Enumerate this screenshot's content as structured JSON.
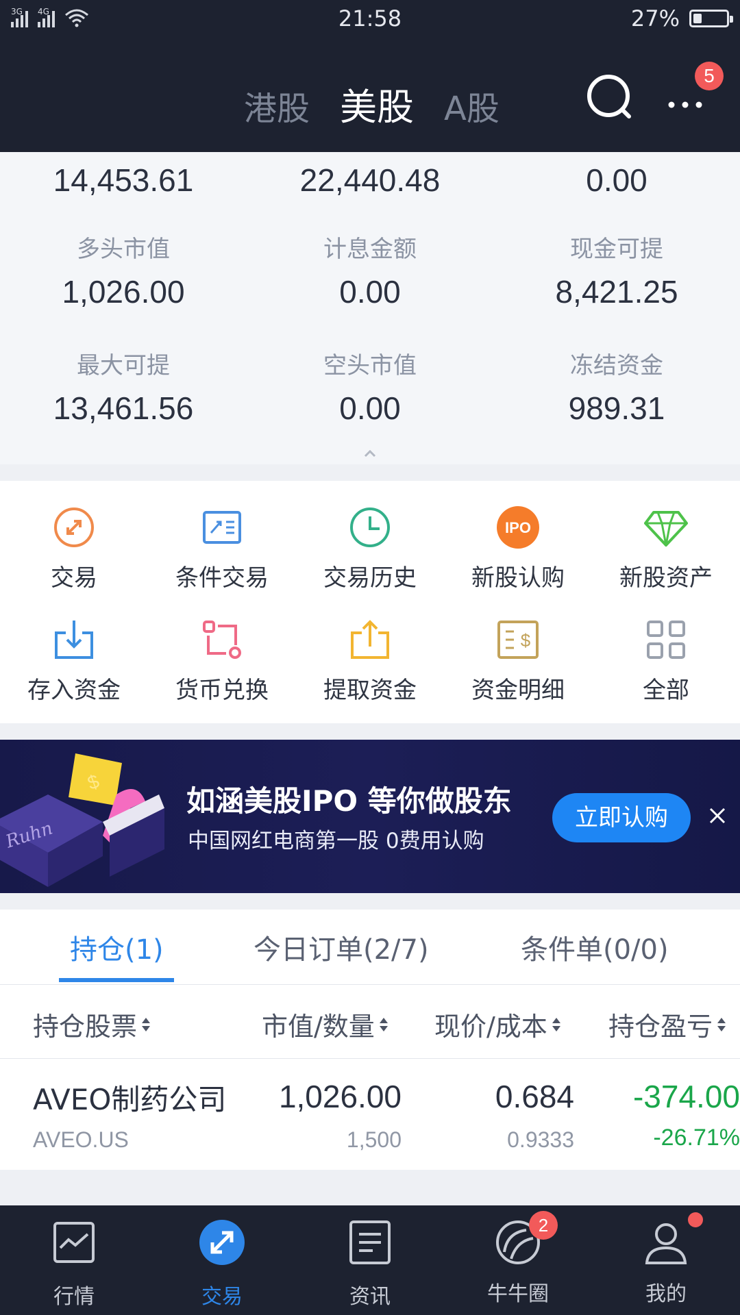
{
  "status_bar": {
    "sig1": "3G",
    "sig2": "4G",
    "time": "21:58",
    "battery_text": "27%",
    "battery_level": 0.27
  },
  "header": {
    "tabs": [
      "港股",
      "美股",
      "A股"
    ],
    "active_tab": "美股",
    "more_badge": "5"
  },
  "summary": {
    "row0": [
      "14,453.61",
      "22,440.48",
      "0.00"
    ],
    "cells": [
      {
        "label": "多头市值",
        "value": "1,026.00"
      },
      {
        "label": "计息金额",
        "value": "0.00"
      },
      {
        "label": "现金可提",
        "value": "8,421.25"
      },
      {
        "label": "最大可提",
        "value": "13,461.56"
      },
      {
        "label": "空头市值",
        "value": "0.00"
      },
      {
        "label": "冻结资金",
        "value": "989.31"
      }
    ]
  },
  "functions": [
    {
      "label": "交易",
      "icon": "trade-arrows-icon",
      "color": "#f08a4b"
    },
    {
      "label": "条件交易",
      "icon": "conditional-trade-icon",
      "color": "#4a8fe0"
    },
    {
      "label": "交易历史",
      "icon": "clock-icon",
      "color": "#33b08a"
    },
    {
      "label": "新股认购",
      "icon": "ipo-icon",
      "color": "#f57c2a"
    },
    {
      "label": "新股资产",
      "icon": "diamond-icon",
      "color": "#4ec24a"
    },
    {
      "label": "存入资金",
      "icon": "deposit-icon",
      "color": "#3d8fe0"
    },
    {
      "label": "货币兑换",
      "icon": "currency-exchange-icon",
      "color": "#ef6a86"
    },
    {
      "label": "提取资金",
      "icon": "withdraw-icon",
      "color": "#f2b531"
    },
    {
      "label": "资金明细",
      "icon": "fund-details-icon",
      "color": "#c3a35a"
    },
    {
      "label": "全部",
      "icon": "grid-icon",
      "color": "#9aa1ad"
    }
  ],
  "banner": {
    "title": "如涵美股IPO 等你做股东",
    "subtitle": "中国网红电商第一股  0费用认购",
    "button": "立即认购"
  },
  "position_tabs": [
    "持仓(1)",
    "今日订单(2/7)",
    "条件单(0/0)"
  ],
  "table": {
    "headers": [
      "持仓股票",
      "市值/数量",
      "现价/成本",
      "持仓盈亏"
    ],
    "rows": [
      {
        "name": "AVEO制药公司",
        "symbol": "AVEO.US",
        "market_value": "1,026.00",
        "quantity": "1,500",
        "price": "0.684",
        "cost": "0.9333",
        "pnl": "-374.00",
        "pnl_pct": "-26.71%"
      }
    ]
  },
  "bottom_nav": [
    {
      "label": "行情",
      "icon": "chart-icon"
    },
    {
      "label": "交易",
      "icon": "trade-icon",
      "active": true
    },
    {
      "label": "资讯",
      "icon": "news-icon"
    },
    {
      "label": "牛牛圈",
      "icon": "community-icon",
      "badge": "2"
    },
    {
      "label": "我的",
      "icon": "profile-icon",
      "dot": true
    }
  ],
  "colors": {
    "accent": "#2e86e8",
    "header_bg": "#1d2230",
    "gain_loss": "#1aa64a",
    "badge": "#f25a5a"
  }
}
